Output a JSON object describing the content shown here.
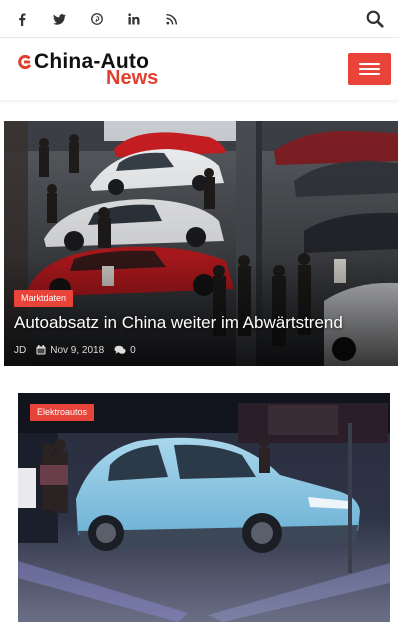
{
  "topbar": {
    "social_icons": [
      "facebook-icon",
      "twitter-icon",
      "pinterest-icon",
      "linkedin-icon",
      "rss-icon"
    ],
    "search_icon": "search-icon"
  },
  "header": {
    "logo_line1": "China-Auto",
    "logo_line2": "News",
    "accent_color": "#e8443a",
    "menu_icon": "hamburger-icon"
  },
  "articles": [
    {
      "category": "Marktdaten",
      "title": "Autoabsatz in China weiter im Abwärtstrend",
      "author": "JD",
      "date": "Nov 9, 2018",
      "comments": "0"
    },
    {
      "category": "Elektroautos"
    }
  ]
}
